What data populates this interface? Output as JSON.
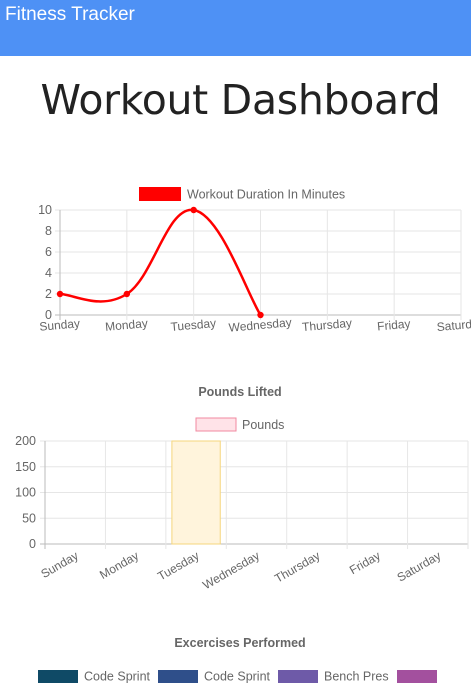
{
  "navbar": {
    "brand": "Fitness Tracker"
  },
  "page": {
    "title": "Workout Dashboard"
  },
  "chart_data": [
    {
      "type": "line",
      "title": "",
      "categories": [
        "Sunday",
        "Monday",
        "Tuesday",
        "Wednesday",
        "Thursday",
        "Friday",
        "Saturday"
      ],
      "series": [
        {
          "name": "Workout Duration In Minutes",
          "values": [
            2,
            2,
            10,
            0,
            null,
            null,
            null
          ],
          "color": "#ff0000"
        }
      ],
      "ylim": [
        0,
        10
      ],
      "yticks": [
        "0",
        "2",
        "4",
        "6",
        "8",
        "10"
      ],
      "grid": true,
      "legend": "top"
    },
    {
      "type": "bar",
      "title": "Pounds Lifted",
      "categories": [
        "Sunday",
        "Monday",
        "Tuesday",
        "Wednesday",
        "Thursday",
        "Friday",
        "Saturday"
      ],
      "series": [
        {
          "name": "Pounds",
          "values": [
            0,
            0,
            200,
            0,
            0,
            0,
            0
          ],
          "color": "#ffe3e8",
          "border": "#f08aa0",
          "bar_fill": "#fff4dc",
          "bar_border": "#f5d67d"
        }
      ],
      "ylim": [
        0,
        200
      ],
      "yticks": [
        "0",
        "50",
        "100",
        "150",
        "200"
      ],
      "grid": true,
      "legend": "top"
    },
    {
      "type": "pie",
      "title": "Excercises Performed",
      "legend_items": [
        {
          "label": "Code Sprint",
          "color": "#0f4a66"
        },
        {
          "label": "Code Sprint",
          "color": "#2f4f8a"
        },
        {
          "label": "Bench Pres",
          "color": "#6e5aa8"
        },
        {
          "label": "",
          "color": "#a3509e"
        }
      ],
      "legend": "top"
    }
  ]
}
